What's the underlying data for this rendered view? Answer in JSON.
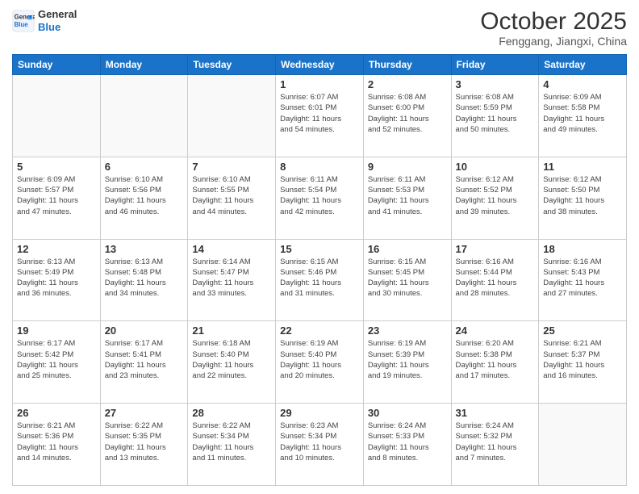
{
  "logo": {
    "line1": "General",
    "line2": "Blue"
  },
  "header": {
    "month": "October 2025",
    "location": "Fenggang, Jiangxi, China"
  },
  "weekdays": [
    "Sunday",
    "Monday",
    "Tuesday",
    "Wednesday",
    "Thursday",
    "Friday",
    "Saturday"
  ],
  "weeks": [
    [
      {
        "day": "",
        "info": ""
      },
      {
        "day": "",
        "info": ""
      },
      {
        "day": "",
        "info": ""
      },
      {
        "day": "1",
        "info": "Sunrise: 6:07 AM\nSunset: 6:01 PM\nDaylight: 11 hours\nand 54 minutes."
      },
      {
        "day": "2",
        "info": "Sunrise: 6:08 AM\nSunset: 6:00 PM\nDaylight: 11 hours\nand 52 minutes."
      },
      {
        "day": "3",
        "info": "Sunrise: 6:08 AM\nSunset: 5:59 PM\nDaylight: 11 hours\nand 50 minutes."
      },
      {
        "day": "4",
        "info": "Sunrise: 6:09 AM\nSunset: 5:58 PM\nDaylight: 11 hours\nand 49 minutes."
      }
    ],
    [
      {
        "day": "5",
        "info": "Sunrise: 6:09 AM\nSunset: 5:57 PM\nDaylight: 11 hours\nand 47 minutes."
      },
      {
        "day": "6",
        "info": "Sunrise: 6:10 AM\nSunset: 5:56 PM\nDaylight: 11 hours\nand 46 minutes."
      },
      {
        "day": "7",
        "info": "Sunrise: 6:10 AM\nSunset: 5:55 PM\nDaylight: 11 hours\nand 44 minutes."
      },
      {
        "day": "8",
        "info": "Sunrise: 6:11 AM\nSunset: 5:54 PM\nDaylight: 11 hours\nand 42 minutes."
      },
      {
        "day": "9",
        "info": "Sunrise: 6:11 AM\nSunset: 5:53 PM\nDaylight: 11 hours\nand 41 minutes."
      },
      {
        "day": "10",
        "info": "Sunrise: 6:12 AM\nSunset: 5:52 PM\nDaylight: 11 hours\nand 39 minutes."
      },
      {
        "day": "11",
        "info": "Sunrise: 6:12 AM\nSunset: 5:50 PM\nDaylight: 11 hours\nand 38 minutes."
      }
    ],
    [
      {
        "day": "12",
        "info": "Sunrise: 6:13 AM\nSunset: 5:49 PM\nDaylight: 11 hours\nand 36 minutes."
      },
      {
        "day": "13",
        "info": "Sunrise: 6:13 AM\nSunset: 5:48 PM\nDaylight: 11 hours\nand 34 minutes."
      },
      {
        "day": "14",
        "info": "Sunrise: 6:14 AM\nSunset: 5:47 PM\nDaylight: 11 hours\nand 33 minutes."
      },
      {
        "day": "15",
        "info": "Sunrise: 6:15 AM\nSunset: 5:46 PM\nDaylight: 11 hours\nand 31 minutes."
      },
      {
        "day": "16",
        "info": "Sunrise: 6:15 AM\nSunset: 5:45 PM\nDaylight: 11 hours\nand 30 minutes."
      },
      {
        "day": "17",
        "info": "Sunrise: 6:16 AM\nSunset: 5:44 PM\nDaylight: 11 hours\nand 28 minutes."
      },
      {
        "day": "18",
        "info": "Sunrise: 6:16 AM\nSunset: 5:43 PM\nDaylight: 11 hours\nand 27 minutes."
      }
    ],
    [
      {
        "day": "19",
        "info": "Sunrise: 6:17 AM\nSunset: 5:42 PM\nDaylight: 11 hours\nand 25 minutes."
      },
      {
        "day": "20",
        "info": "Sunrise: 6:17 AM\nSunset: 5:41 PM\nDaylight: 11 hours\nand 23 minutes."
      },
      {
        "day": "21",
        "info": "Sunrise: 6:18 AM\nSunset: 5:40 PM\nDaylight: 11 hours\nand 22 minutes."
      },
      {
        "day": "22",
        "info": "Sunrise: 6:19 AM\nSunset: 5:40 PM\nDaylight: 11 hours\nand 20 minutes."
      },
      {
        "day": "23",
        "info": "Sunrise: 6:19 AM\nSunset: 5:39 PM\nDaylight: 11 hours\nand 19 minutes."
      },
      {
        "day": "24",
        "info": "Sunrise: 6:20 AM\nSunset: 5:38 PM\nDaylight: 11 hours\nand 17 minutes."
      },
      {
        "day": "25",
        "info": "Sunrise: 6:21 AM\nSunset: 5:37 PM\nDaylight: 11 hours\nand 16 minutes."
      }
    ],
    [
      {
        "day": "26",
        "info": "Sunrise: 6:21 AM\nSunset: 5:36 PM\nDaylight: 11 hours\nand 14 minutes."
      },
      {
        "day": "27",
        "info": "Sunrise: 6:22 AM\nSunset: 5:35 PM\nDaylight: 11 hours\nand 13 minutes."
      },
      {
        "day": "28",
        "info": "Sunrise: 6:22 AM\nSunset: 5:34 PM\nDaylight: 11 hours\nand 11 minutes."
      },
      {
        "day": "29",
        "info": "Sunrise: 6:23 AM\nSunset: 5:34 PM\nDaylight: 11 hours\nand 10 minutes."
      },
      {
        "day": "30",
        "info": "Sunrise: 6:24 AM\nSunset: 5:33 PM\nDaylight: 11 hours\nand 8 minutes."
      },
      {
        "day": "31",
        "info": "Sunrise: 6:24 AM\nSunset: 5:32 PM\nDaylight: 11 hours\nand 7 minutes."
      },
      {
        "day": "",
        "info": ""
      }
    ]
  ]
}
